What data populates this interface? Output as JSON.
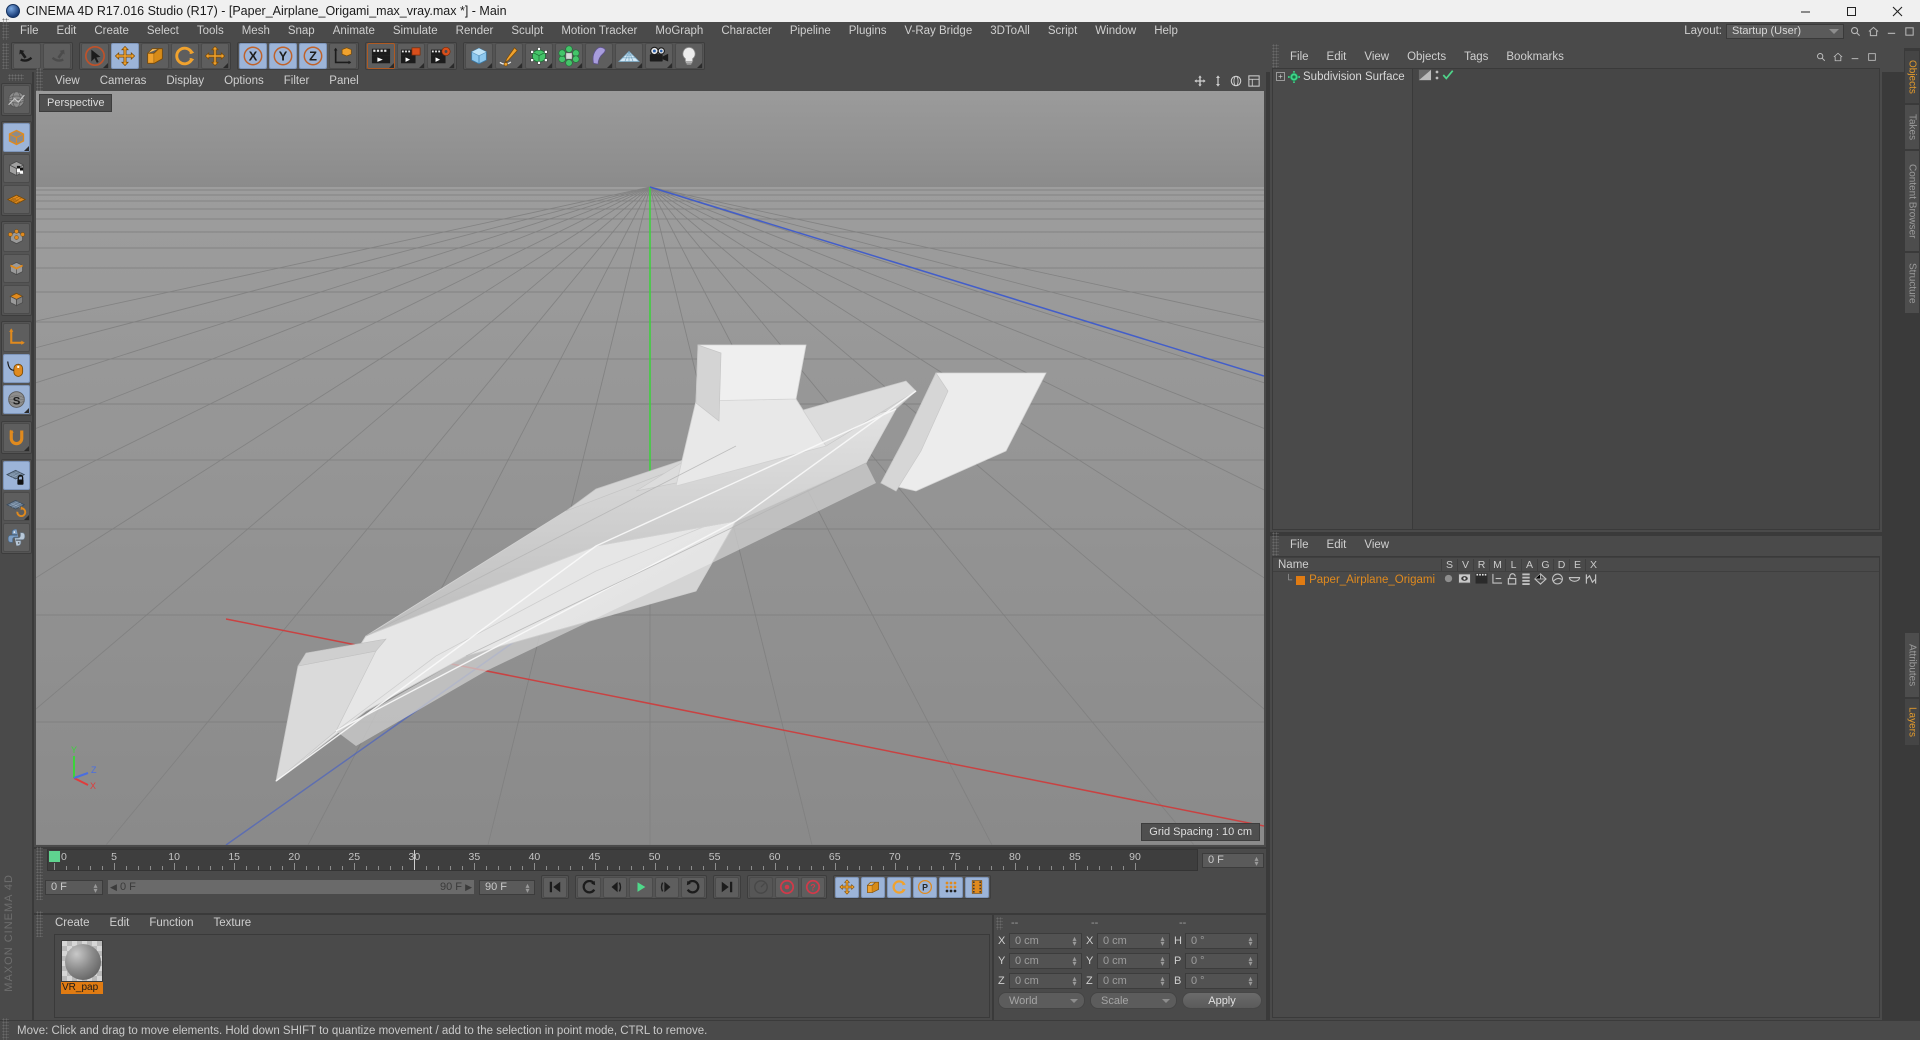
{
  "window": {
    "title": "CINEMA 4D R17.016 Studio (R17) - [Paper_Airplane_Origami_max_vray.max *] - Main",
    "app_icon": "cinema4d-logo-icon",
    "controls": {
      "minimize": "minimize-button",
      "maximize": "maximize-button",
      "close": "close-button"
    }
  },
  "menubar": {
    "items": [
      "File",
      "Edit",
      "Create",
      "Select",
      "Tools",
      "Mesh",
      "Snap",
      "Animate",
      "Simulate",
      "Render",
      "Sculpt",
      "Motion Tracker",
      "MoGraph",
      "Character",
      "Pipeline",
      "Plugins",
      "V-Ray Bridge",
      "3DToAll",
      "Script",
      "Window",
      "Help"
    ],
    "layout_label": "Layout:",
    "layout_value": "Startup (User)",
    "search_icon": "search-icon",
    "home_icon": "home-icon"
  },
  "toolbar": {
    "groups": [
      {
        "name": "history",
        "buttons": [
          {
            "name": "undo-button",
            "icon": "undo-arrow-icon",
            "active": false,
            "has_menu": false
          },
          {
            "name": "redo-button",
            "icon": "redo-arrow-icon",
            "active": false,
            "has_menu": false
          }
        ]
      },
      {
        "name": "transform-tools",
        "buttons": [
          {
            "name": "live-selection-tool",
            "icon": "cursor-circle-icon",
            "active": false,
            "has_menu": true
          },
          {
            "name": "move-tool",
            "icon": "move-cross-icon",
            "active": true,
            "has_menu": false
          },
          {
            "name": "scale-tool",
            "icon": "scale-box-icon",
            "active": false,
            "has_menu": false
          },
          {
            "name": "rotate-tool",
            "icon": "rotate-circle-icon",
            "active": false,
            "has_menu": false
          },
          {
            "name": "move-alt-tool",
            "icon": "move-cross-icon",
            "active": false,
            "has_menu": true
          }
        ]
      },
      {
        "name": "axis-locks",
        "buttons": [
          {
            "name": "x-axis-lock-button",
            "icon": "x-axis-icon",
            "active": true,
            "has_menu": false
          },
          {
            "name": "y-axis-lock-button",
            "icon": "y-axis-icon",
            "active": true,
            "has_menu": false
          },
          {
            "name": "z-axis-lock-button",
            "icon": "z-axis-icon",
            "active": true,
            "has_menu": false
          },
          {
            "name": "world-object-coord-button",
            "icon": "world-axis-cube-icon",
            "active": false,
            "has_menu": false
          }
        ]
      },
      {
        "name": "render-tools",
        "buttons": [
          {
            "name": "render-view-button",
            "icon": "clapperboard-icon",
            "active": false,
            "has_menu": true
          },
          {
            "name": "render-to-picture-viewer-button",
            "icon": "clapperboard-picture-icon",
            "active": false,
            "has_menu": true
          },
          {
            "name": "render-settings-button",
            "icon": "clapperboard-gear-icon",
            "active": false,
            "has_menu": true
          }
        ]
      },
      {
        "name": "creation-tools",
        "buttons": [
          {
            "name": "add-cube-button",
            "icon": "blue-cube-icon",
            "active": false,
            "has_menu": true
          },
          {
            "name": "add-spline-button",
            "icon": "pen-spline-icon",
            "active": false,
            "has_menu": true
          },
          {
            "name": "add-generator-button",
            "icon": "green-nurbs-cube-icon",
            "active": false,
            "has_menu": true
          },
          {
            "name": "add-array-button",
            "icon": "green-array-icon",
            "active": false,
            "has_menu": true
          },
          {
            "name": "add-deformer-button",
            "icon": "purple-bend-deformer-icon",
            "active": false,
            "has_menu": true
          },
          {
            "name": "add-scene-object-button",
            "icon": "floor-grid-icon",
            "active": false,
            "has_menu": true
          },
          {
            "name": "add-camera-button",
            "icon": "camera-icon",
            "active": false,
            "has_menu": true
          },
          {
            "name": "add-light-button",
            "icon": "lightbulb-icon",
            "active": false,
            "has_menu": true
          }
        ]
      }
    ]
  },
  "left_palette": {
    "groups": [
      {
        "buttons": [
          {
            "name": "make-editable-button",
            "icon": "globe-wireframe-icon",
            "active": false
          }
        ]
      },
      {
        "buttons": [
          {
            "name": "model-mode-button",
            "icon": "model-cube-icon",
            "active": true
          },
          {
            "name": "texture-mode-button",
            "icon": "texture-cube-icon",
            "active": false
          },
          {
            "name": "workplane-mode-button",
            "icon": "workplane-grid-icon",
            "active": false
          }
        ]
      },
      {
        "buttons": [
          {
            "name": "points-mode-button",
            "icon": "points-cube-icon",
            "active": false
          },
          {
            "name": "edges-mode-button",
            "icon": "edges-cube-icon",
            "active": false
          },
          {
            "name": "polygons-mode-button",
            "icon": "polygons-cube-icon",
            "active": false
          }
        ]
      },
      {
        "buttons": [
          {
            "name": "object-axis-button",
            "icon": "axis-corner-icon",
            "active": false
          },
          {
            "name": "viewport-solo-button",
            "icon": "mouse-icon",
            "active": true
          },
          {
            "name": "enable-snapping-button",
            "icon": "s-snap-icon",
            "active": true
          }
        ]
      },
      {
        "buttons": [
          {
            "name": "magnet-tool-button",
            "icon": "magnet-icon",
            "active": false
          }
        ]
      },
      {
        "buttons": [
          {
            "name": "lock-workplane-button",
            "icon": "grid-lock-icon",
            "active": true
          },
          {
            "name": "planar-workplane-button",
            "icon": "grid-rotate-icon",
            "active": false
          },
          {
            "name": "python-console-button",
            "icon": "python-icon",
            "active": false
          }
        ]
      }
    ],
    "branding": "MAXON CINEMA 4D"
  },
  "viewport": {
    "menu": [
      "View",
      "Cameras",
      "Display",
      "Options",
      "Filter",
      "Panel"
    ],
    "nav_icons": [
      "pan-icon",
      "dolly-icon",
      "orbit-icon",
      "maximize-viewport-icon"
    ],
    "label": "Perspective",
    "grid_spacing": "Grid Spacing : 10 cm",
    "axis_labels": {
      "x": "X",
      "y": "Y",
      "z": "Z"
    },
    "axis_colors": {
      "x": "#e03b3b",
      "y": "#3bd43b",
      "z": "#4a6ee0"
    },
    "model_name": "Paper Airplane Origami"
  },
  "timeline": {
    "ruler_start": 0,
    "ruler_end": 90,
    "tick_labels": [
      "0",
      "5",
      "10",
      "15",
      "20",
      "25",
      "30",
      "35",
      "40",
      "45",
      "50",
      "55",
      "60",
      "65",
      "70",
      "75",
      "80",
      "85",
      "90"
    ],
    "current_frame_right": "0 F",
    "current_frame_left": "0 F",
    "scrub_start": "0 F",
    "scrub_end": "90 F",
    "end_frame_field": "90 F",
    "playhead_frame": 30,
    "playback_buttons": [
      {
        "name": "go-to-start-button",
        "icon": "skip-start-icon"
      },
      {
        "name": "previous-keyframe-button",
        "icon": "prev-key-icon"
      },
      {
        "name": "step-back-button",
        "icon": "step-back-icon"
      },
      {
        "name": "play-button",
        "icon": "play-icon"
      },
      {
        "name": "step-forward-button",
        "icon": "step-forward-icon"
      },
      {
        "name": "next-keyframe-button",
        "icon": "next-key-icon"
      },
      {
        "name": "go-to-end-button",
        "icon": "skip-end-icon"
      }
    ],
    "record_buttons": [
      {
        "name": "autokey-toggle-button",
        "icon": "speedometer-icon",
        "active": false
      },
      {
        "name": "record-active-objects-button",
        "icon": "record-circle-icon",
        "active": false
      },
      {
        "name": "autokeying-button",
        "icon": "record-question-icon",
        "active": false
      }
    ],
    "key_filter_buttons": [
      {
        "name": "key-position-button",
        "icon": "move-cross-icon",
        "active": true
      },
      {
        "name": "key-scale-button",
        "icon": "scale-box-icon",
        "active": true
      },
      {
        "name": "key-rotation-button",
        "icon": "rotate-circle-icon",
        "active": true
      },
      {
        "name": "key-parameter-button",
        "icon": "p-circle-icon",
        "active": true
      },
      {
        "name": "key-pla-button",
        "icon": "point-grid-icon",
        "active": true
      },
      {
        "name": "key-frames-button",
        "icon": "filmstrip-icon",
        "active": true
      }
    ]
  },
  "material_manager": {
    "menu": [
      "Create",
      "Edit",
      "Function",
      "Texture"
    ],
    "materials": [
      {
        "name": "VR_pap",
        "full_name": "VR_paper",
        "selected": true
      }
    ]
  },
  "coordinates": {
    "header": [
      "--",
      "--",
      "--"
    ],
    "rows": [
      {
        "pos_label": "X",
        "pos_value": "0 cm",
        "size_label": "X",
        "size_value": "0 cm",
        "rot_label": "H",
        "rot_value": "0 °"
      },
      {
        "pos_label": "Y",
        "pos_value": "0 cm",
        "size_label": "Y",
        "size_value": "0 cm",
        "rot_label": "P",
        "rot_value": "0 °"
      },
      {
        "pos_label": "Z",
        "pos_value": "0 cm",
        "size_label": "Z",
        "size_value": "0 cm",
        "rot_label": "B",
        "rot_value": "0 °"
      }
    ],
    "coord_system": "World",
    "transform_mode": "Scale",
    "apply_label": "Apply"
  },
  "object_manager": {
    "menu": [
      "File",
      "Edit",
      "View",
      "Objects",
      "Tags",
      "Bookmarks"
    ],
    "rows": [
      {
        "label": "Subdivision Surface",
        "icon": "subdivision-surface-icon",
        "expandable": true,
        "tags": [
          "hide-toggle-icon",
          "visibility-dots-icon",
          "green-check-icon"
        ]
      }
    ]
  },
  "layer_manager": {
    "menu": [
      "File",
      "Edit",
      "View"
    ],
    "columns": [
      "Name",
      "S",
      "V",
      "R",
      "M",
      "L",
      "A",
      "G",
      "D",
      "E",
      "X"
    ],
    "rows": [
      {
        "name": "Paper_Airplane_Origami",
        "color": "#e07b12",
        "icons": [
          "solo-dot-icon",
          "visible-eye-icon",
          "render-clapper-icon",
          "manager-icon",
          "lock-open-icon",
          "animation-bars-icon",
          "generators-icon",
          "deformers-icon",
          "expressions-icon",
          "xpresso-icon"
        ]
      }
    ]
  },
  "right_tabs": {
    "top": [
      {
        "label": "Objects",
        "selected": true
      },
      {
        "label": "Takes",
        "selected": false
      },
      {
        "label": "Content Browser",
        "selected": false
      },
      {
        "label": "Structure",
        "selected": false
      }
    ],
    "bottom": [
      {
        "label": "Attributes",
        "selected": false
      },
      {
        "label": "Layers",
        "selected": true
      }
    ]
  },
  "statusbar": {
    "message": "Move: Click and drag to move elements. Hold down SHIFT to quantize movement / add to the selection in point mode, CTRL to remove."
  },
  "colors": {
    "accent_orange": "#e07b12",
    "active_blue": "#9cb4d8",
    "panel_bg": "#4a4a4a",
    "viewport_gray": "#8e8e8e",
    "title_bg": "#f0f0f0"
  }
}
